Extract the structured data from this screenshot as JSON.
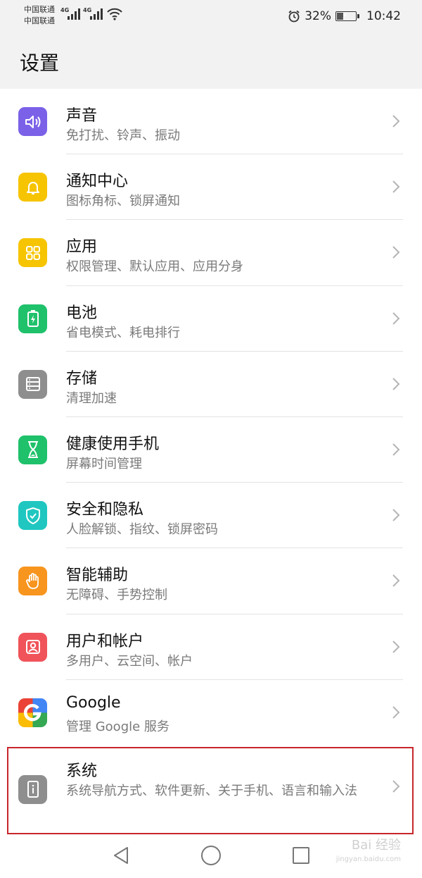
{
  "status_bar": {
    "carrier_1": "中国联通",
    "carrier_2": "中国联通",
    "net_type_1": "4G",
    "net_type_2": "4G",
    "battery_percent": "32%",
    "battery_level": 0.32,
    "time": "10:42",
    "alarm_icon": "alarm-clock-icon",
    "wifi_icon": "wifi-icon"
  },
  "header": {
    "title": "设置"
  },
  "settings": [
    {
      "title": "声音",
      "subtitle": "免打扰、铃声、振动",
      "icon": "speaker-icon",
      "color": "#7b61e8"
    },
    {
      "title": "通知中心",
      "subtitle": "图标角标、锁屏通知",
      "icon": "bell-icon",
      "color": "#f6c400"
    },
    {
      "title": "应用",
      "subtitle": "权限管理、默认应用、应用分身",
      "icon": "apps-grid-icon",
      "color": "#f6c400"
    },
    {
      "title": "电池",
      "subtitle": "省电模式、耗电排行",
      "icon": "battery-icon",
      "color": "#1fc16b"
    },
    {
      "title": "存储",
      "subtitle": "清理加速",
      "icon": "storage-icon",
      "color": "#8e8e8e"
    },
    {
      "title": "健康使用手机",
      "subtitle": "屏幕时间管理",
      "icon": "hourglass-icon",
      "color": "#1fc16b"
    },
    {
      "title": "安全和隐私",
      "subtitle": "人脸解锁、指纹、锁屏密码",
      "icon": "shield-icon",
      "color": "#1fc7c0"
    },
    {
      "title": "智能辅助",
      "subtitle": "无障碍、手势控制",
      "icon": "hand-icon",
      "color": "#f7951e"
    },
    {
      "title": "用户和帐户",
      "subtitle": "多用户、云空间、帐户",
      "icon": "user-icon",
      "color": "#f0535a"
    },
    {
      "title": "Google",
      "subtitle": "管理 Google 服务",
      "icon": "google-icon",
      "color": "#4285f4"
    },
    {
      "title": "系统",
      "subtitle": "系统导航方式、软件更新、关于手机、语言和输入法",
      "icon": "phone-info-icon",
      "color": "#8e8e8e"
    }
  ],
  "nav_bar": {
    "back_icon": "back-triangle-icon",
    "home_icon": "home-circle-icon",
    "recents_icon": "recents-square-icon"
  },
  "watermark": {
    "text": "Bai 经验",
    "url": "jingyan.baidu.com"
  }
}
